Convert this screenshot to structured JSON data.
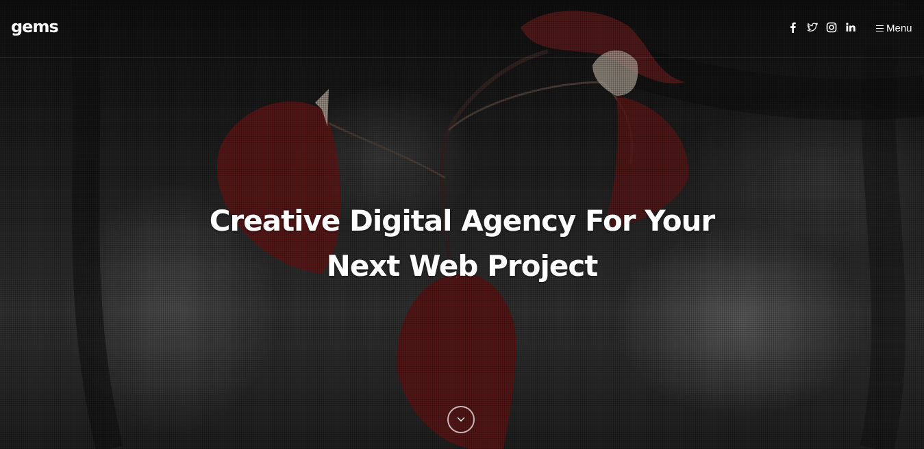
{
  "header": {
    "logo": "gems",
    "social": [
      {
        "icon": "facebook-icon"
      },
      {
        "icon": "twitter-icon"
      },
      {
        "icon": "instagram-icon"
      },
      {
        "icon": "linkedin-icon"
      }
    ],
    "menu_label": "Menu"
  },
  "hero": {
    "headline_line1": "Creative Digital Agency For Your",
    "headline_line2": "Next Web Project",
    "scroll_icon": "chevron-down-icon"
  },
  "colors": {
    "text": "#ffffff",
    "leaf": "#7a1f1f",
    "background": "#2a2a2a"
  }
}
